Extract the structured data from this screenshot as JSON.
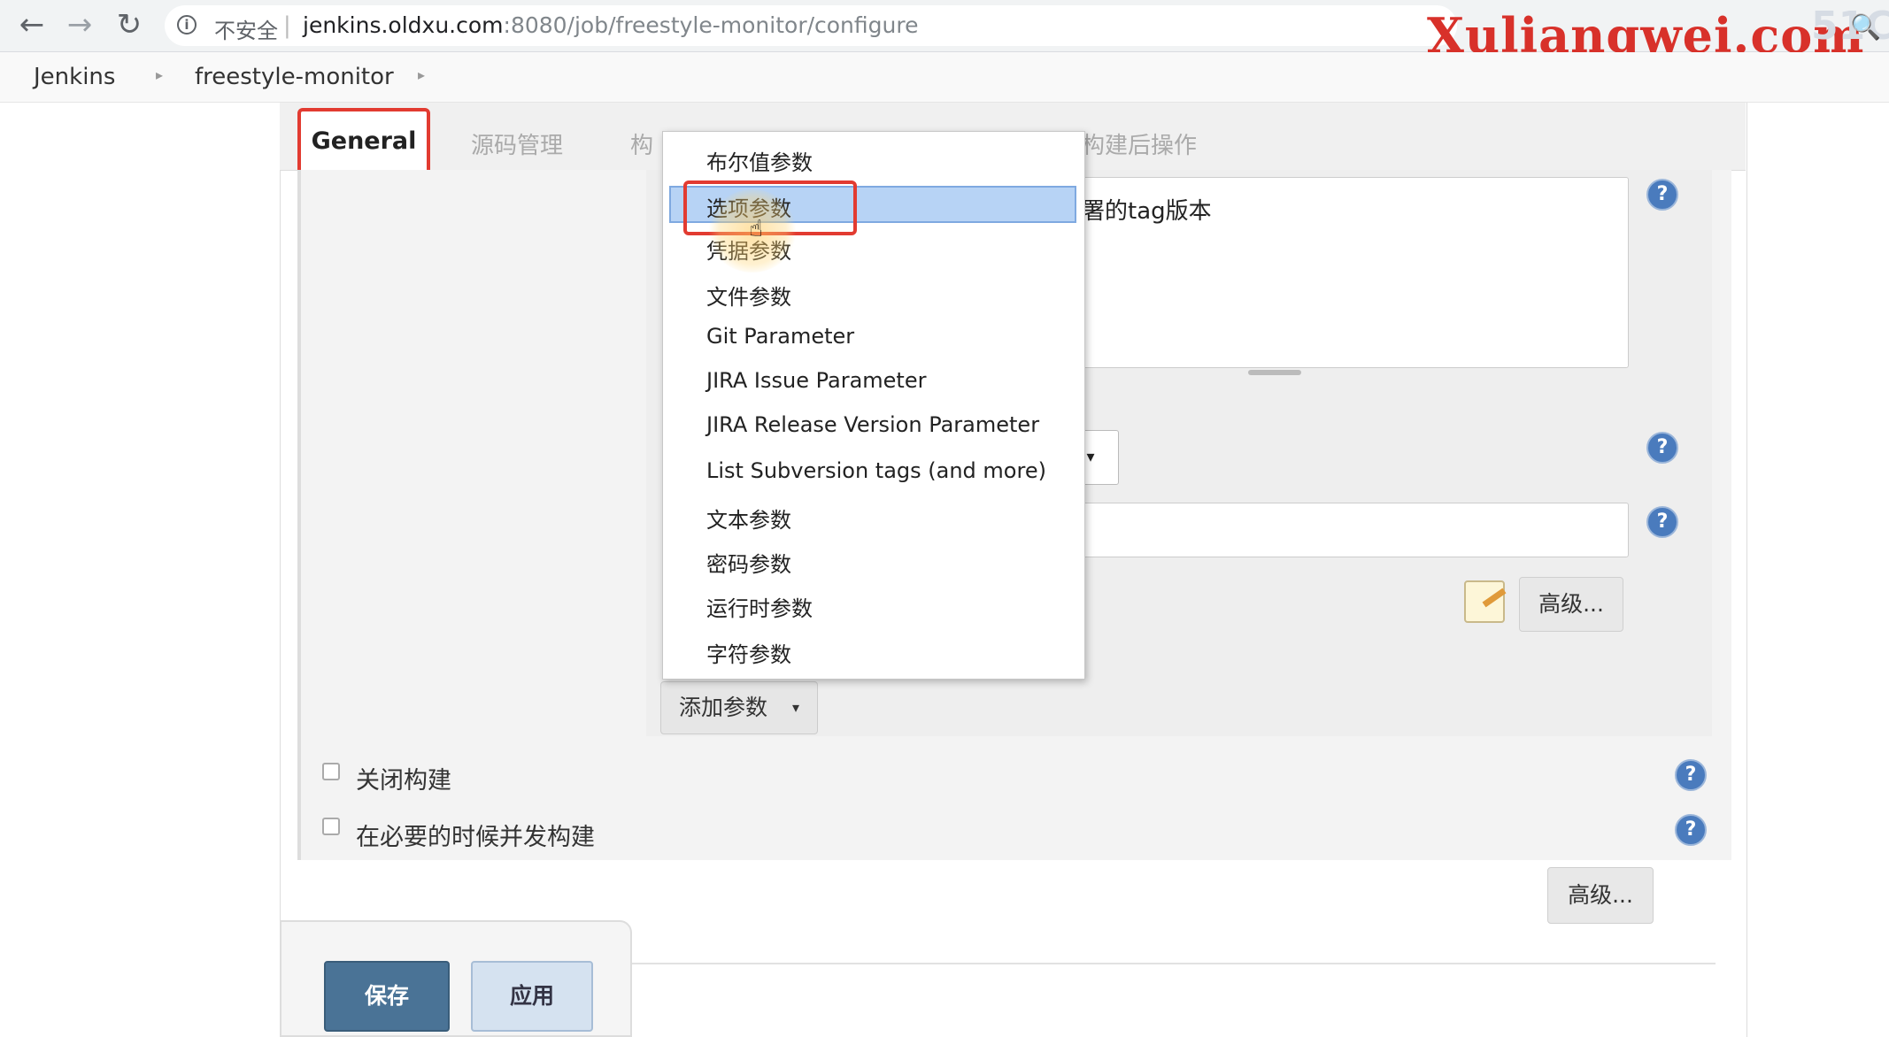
{
  "browser": {
    "security_label": "不安全",
    "url_main": "jenkins.oldxu.com",
    "url_rest": ":8080/job/freestyle-monitor/configure",
    "watermark": "Xuliangwei.com",
    "corner_logo": "51C"
  },
  "breadcrumb": {
    "items": [
      "Jenkins",
      "freestyle-monitor"
    ]
  },
  "tabs": {
    "general": "General",
    "source": "源码管理",
    "build_trigger_partial": "构",
    "post_build": "构建后操作"
  },
  "param": {
    "description_partial": "署的tag版本",
    "select_arrow": "▾",
    "advanced_label": "高级...",
    "add_param_label": "添加参数",
    "add_param_caret": "▾"
  },
  "menu": {
    "items": [
      "布尔值参数",
      "选项参数",
      "凭据参数",
      "文件参数",
      "Git Parameter",
      "JIRA Issue Parameter",
      "JIRA Release Version Parameter",
      "List Subversion tags (and more)",
      "文本参数",
      "密码参数",
      "运行时参数",
      "字符参数"
    ],
    "highlighted_index": 1
  },
  "options": {
    "disable_build": "关闭构建",
    "concurrent_build": "在必要的时候并发构建",
    "advanced_label": "高级..."
  },
  "actions": {
    "save": "保存",
    "apply": "应用"
  },
  "colors": {
    "highlight_border": "#e23b31",
    "menu_highlight": "#b7d3f5",
    "save_button": "#4a7396",
    "help_icon": "#4a7bbd"
  }
}
